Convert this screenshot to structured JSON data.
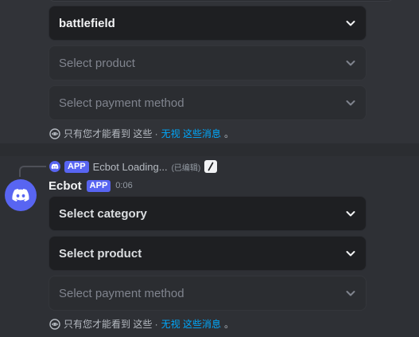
{
  "first_message": {
    "selects": [
      {
        "value": "battlefield",
        "state": "filled"
      },
      {
        "value": "Select product",
        "state": "disabled"
      },
      {
        "value": "Select payment method",
        "state": "disabled"
      }
    ],
    "ephemeral": {
      "text": "只有您才能看到 这些 ·",
      "link": "无视 这些消息",
      "suffix": "。"
    }
  },
  "second_message": {
    "reply": {
      "badge": "APP",
      "text": "Ecbot Loading...",
      "edited": "(已编辑)"
    },
    "author": {
      "name": "Ecbot",
      "badge": "APP",
      "time": "0:06"
    },
    "selects": [
      {
        "value": "Select category",
        "state": "enabled"
      },
      {
        "value": "Select product",
        "state": "enabled"
      },
      {
        "value": "Select payment method",
        "state": "disabled"
      }
    ],
    "ephemeral": {
      "text": "只有您才能看到 这些 ·",
      "link": "无视 这些消息",
      "suffix": "。"
    }
  },
  "colors": {
    "accent": "#5865f2",
    "link": "#00a8fc",
    "background": "#313338",
    "select_bg": "#1e1f22"
  },
  "icons": [
    "chevron-down-icon",
    "eye-icon",
    "discord-icon",
    "slash-command-icon"
  ]
}
